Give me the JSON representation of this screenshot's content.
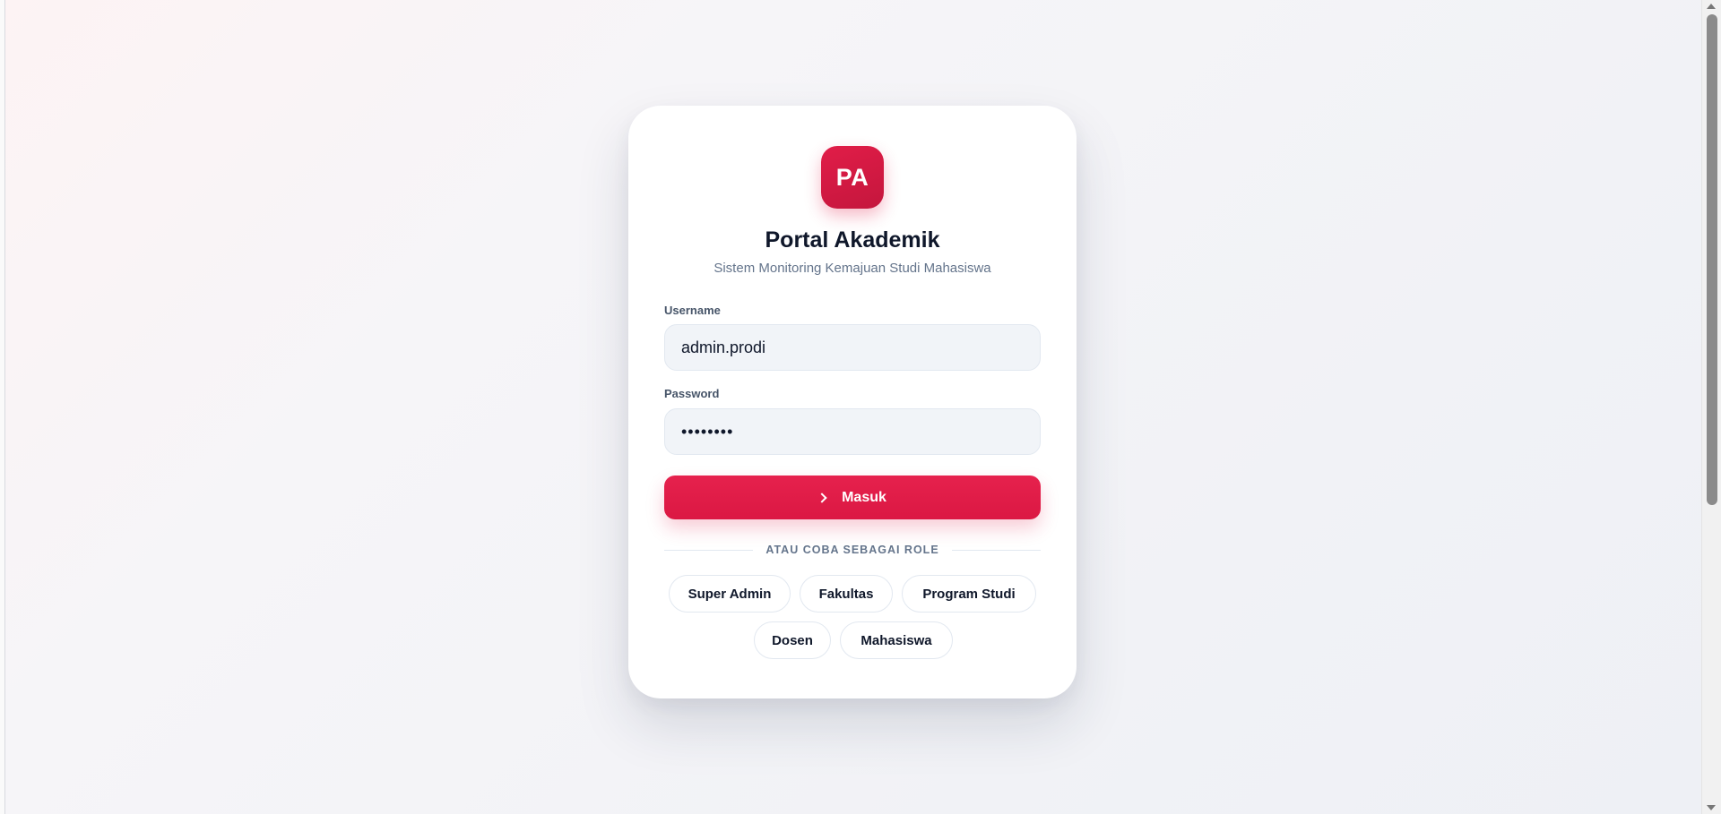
{
  "app": {
    "logo_initials": "PA",
    "title": "Portal Akademik",
    "subtitle": "Sistem Monitoring Kemajuan Studi Mahasiswa"
  },
  "form": {
    "username_label": "Username",
    "username_value": "admin.prodi",
    "password_label": "Password",
    "password_value": "••••••••",
    "submit_label": "Masuk"
  },
  "roles": {
    "divider_text": "ATAU COBA SEBAGAI ROLE",
    "items": [
      "Super Admin",
      "Fakultas",
      "Program Studi",
      "Dosen",
      "Mahasiswa"
    ]
  },
  "icons": {
    "submit": "chevron-right-icon"
  },
  "colors": {
    "accent": "#e11d48",
    "title_text": "#0f172a",
    "muted_text": "#64748b",
    "input_bg": "#f1f4f8"
  }
}
